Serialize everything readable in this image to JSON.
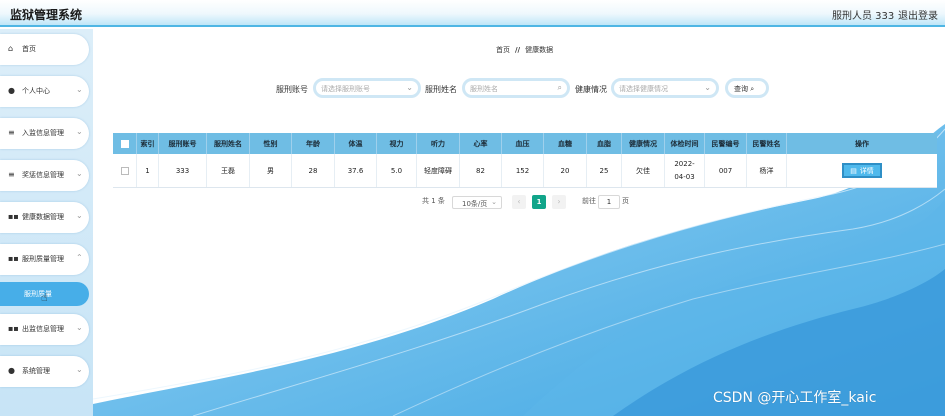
{
  "header": {
    "app_title": "监狱管理系统",
    "user": "服刑人员 333",
    "logout": "退出登录"
  },
  "sidebar": {
    "items": [
      {
        "label": "首页",
        "icon": "home-icon",
        "has_chevron": false
      },
      {
        "label": "个人中心",
        "icon": "user-icon",
        "has_chevron": true
      },
      {
        "label": "入监信息管理",
        "icon": "menu-icon",
        "has_chevron": true
      },
      {
        "label": "奖惩信息管理",
        "icon": "menu-icon",
        "has_chevron": true
      },
      {
        "label": "健康数据管理",
        "icon": "grid-icon",
        "has_chevron": true
      },
      {
        "label": "服刑质量管理",
        "icon": "grid-icon",
        "has_chevron": true
      },
      {
        "label": "出监信息管理",
        "icon": "grid-icon",
        "has_chevron": true
      },
      {
        "label": "系统管理",
        "icon": "pin-icon",
        "has_chevron": true
      }
    ],
    "active_sub_item": "服刑质量"
  },
  "breadcrumb": {
    "home": "首页",
    "sep": "//",
    "current": "健康数据"
  },
  "filters": {
    "account_label": "服刑账号",
    "account_placeholder": "请选择服刑账号",
    "name_label": "服刑姓名",
    "name_placeholder": "服刑姓名",
    "health_label": "健康情况",
    "health_placeholder": "请选择健康情况",
    "query_button": "查询"
  },
  "table": {
    "columns": [
      "索引",
      "服刑账号",
      "服刑姓名",
      "性别",
      "年龄",
      "体温",
      "视力",
      "听力",
      "心率",
      "血压",
      "血糖",
      "血脂",
      "健康情况",
      "体检时间",
      "民警编号",
      "民警姓名",
      "操作"
    ],
    "rows": [
      {
        "index": "1",
        "account": "333",
        "name": "王磊",
        "gender": "男",
        "age": "28",
        "temp": "37.6",
        "vision": "5.0",
        "hearing": "轻度障碍",
        "heart_rate": "82",
        "blood_pressure": "152",
        "blood_sugar": "20",
        "blood_lipid": "25",
        "health": "欠佳",
        "exam_time": "2022-04-03",
        "police_no": "007",
        "police_name": "杨洋",
        "action": "详情"
      }
    ]
  },
  "pagination": {
    "total": "共 1 条",
    "page_size": "10条/页",
    "current_page": "1",
    "goto_label": "前往",
    "goto_value": "1",
    "page_unit": "页",
    "prev": "‹",
    "next": "›"
  },
  "watermark": "CSDN @开心工作室_kaic",
  "colors": {
    "accent": "#47aee8",
    "header_row": "#6fbde4",
    "page_active": "#11a58a"
  }
}
